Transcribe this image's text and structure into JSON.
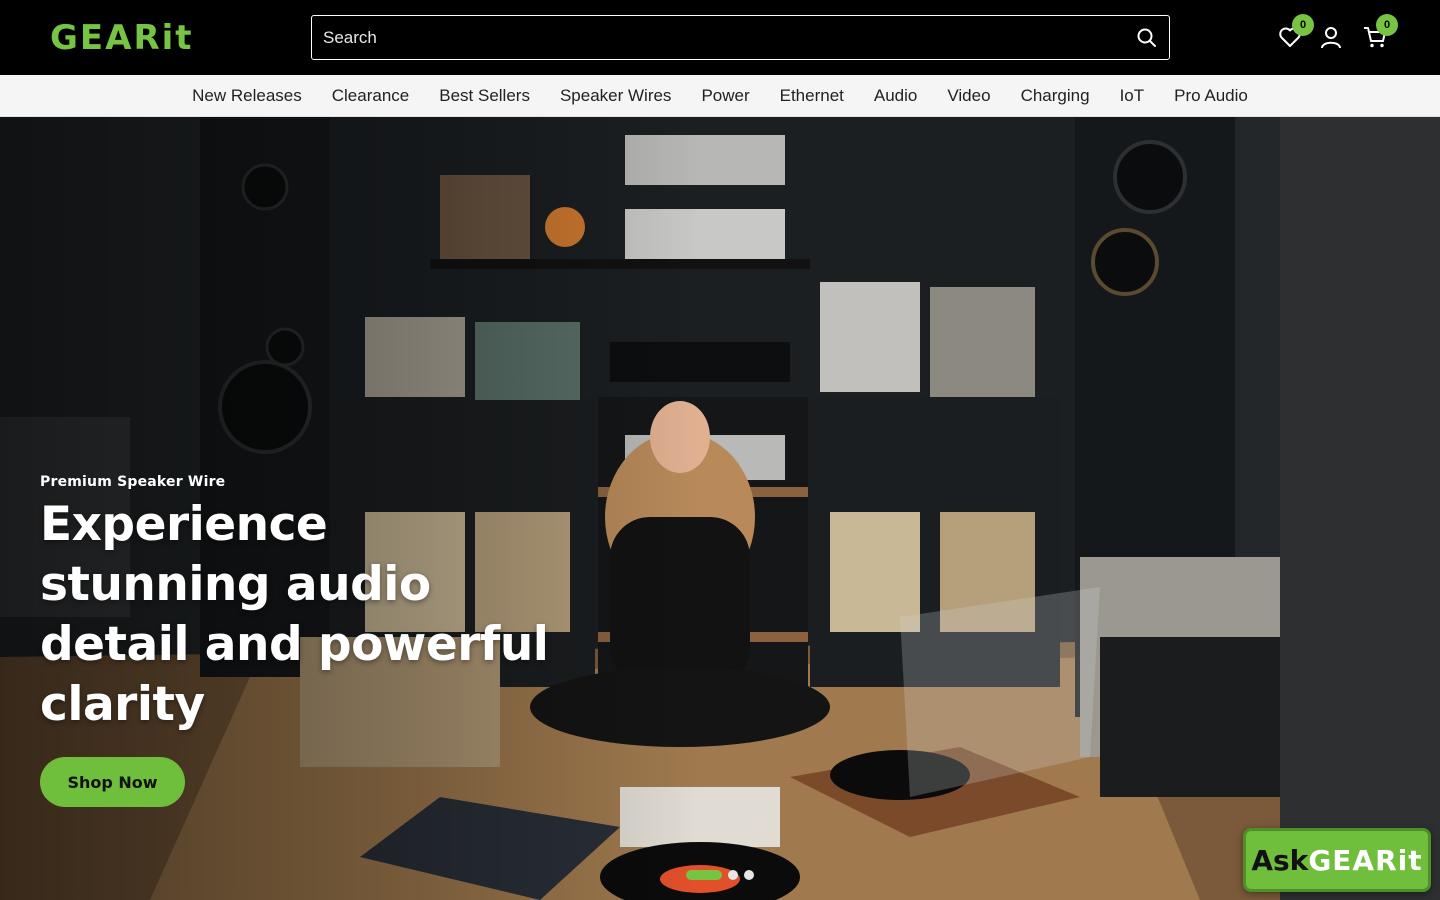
{
  "header": {
    "logo_text": "GEARit",
    "search": {
      "placeholder": "Search",
      "value": ""
    },
    "wishlist_count": "0",
    "cart_count": "0",
    "icons": [
      "heart-icon",
      "user-icon",
      "cart-icon",
      "search-icon"
    ]
  },
  "nav": {
    "items": [
      "New Releases",
      "Clearance",
      "Best Sellers",
      "Speaker Wires",
      "Power",
      "Ethernet",
      "Audio",
      "Video",
      "Charging",
      "IoT",
      "Pro Audio"
    ]
  },
  "hero": {
    "eyebrow": "Premium Speaker Wire",
    "headline": "Experience stunning audio detail and powerful clarity",
    "cta_label": "Shop Now",
    "slides_total": 3,
    "active_slide": 1
  },
  "ask_widget": {
    "ask": "Ask",
    "brand": "GEARit"
  },
  "colors": {
    "brand_green": "#76c442",
    "header_bg": "#000000",
    "nav_bg": "#f5f5f5"
  }
}
